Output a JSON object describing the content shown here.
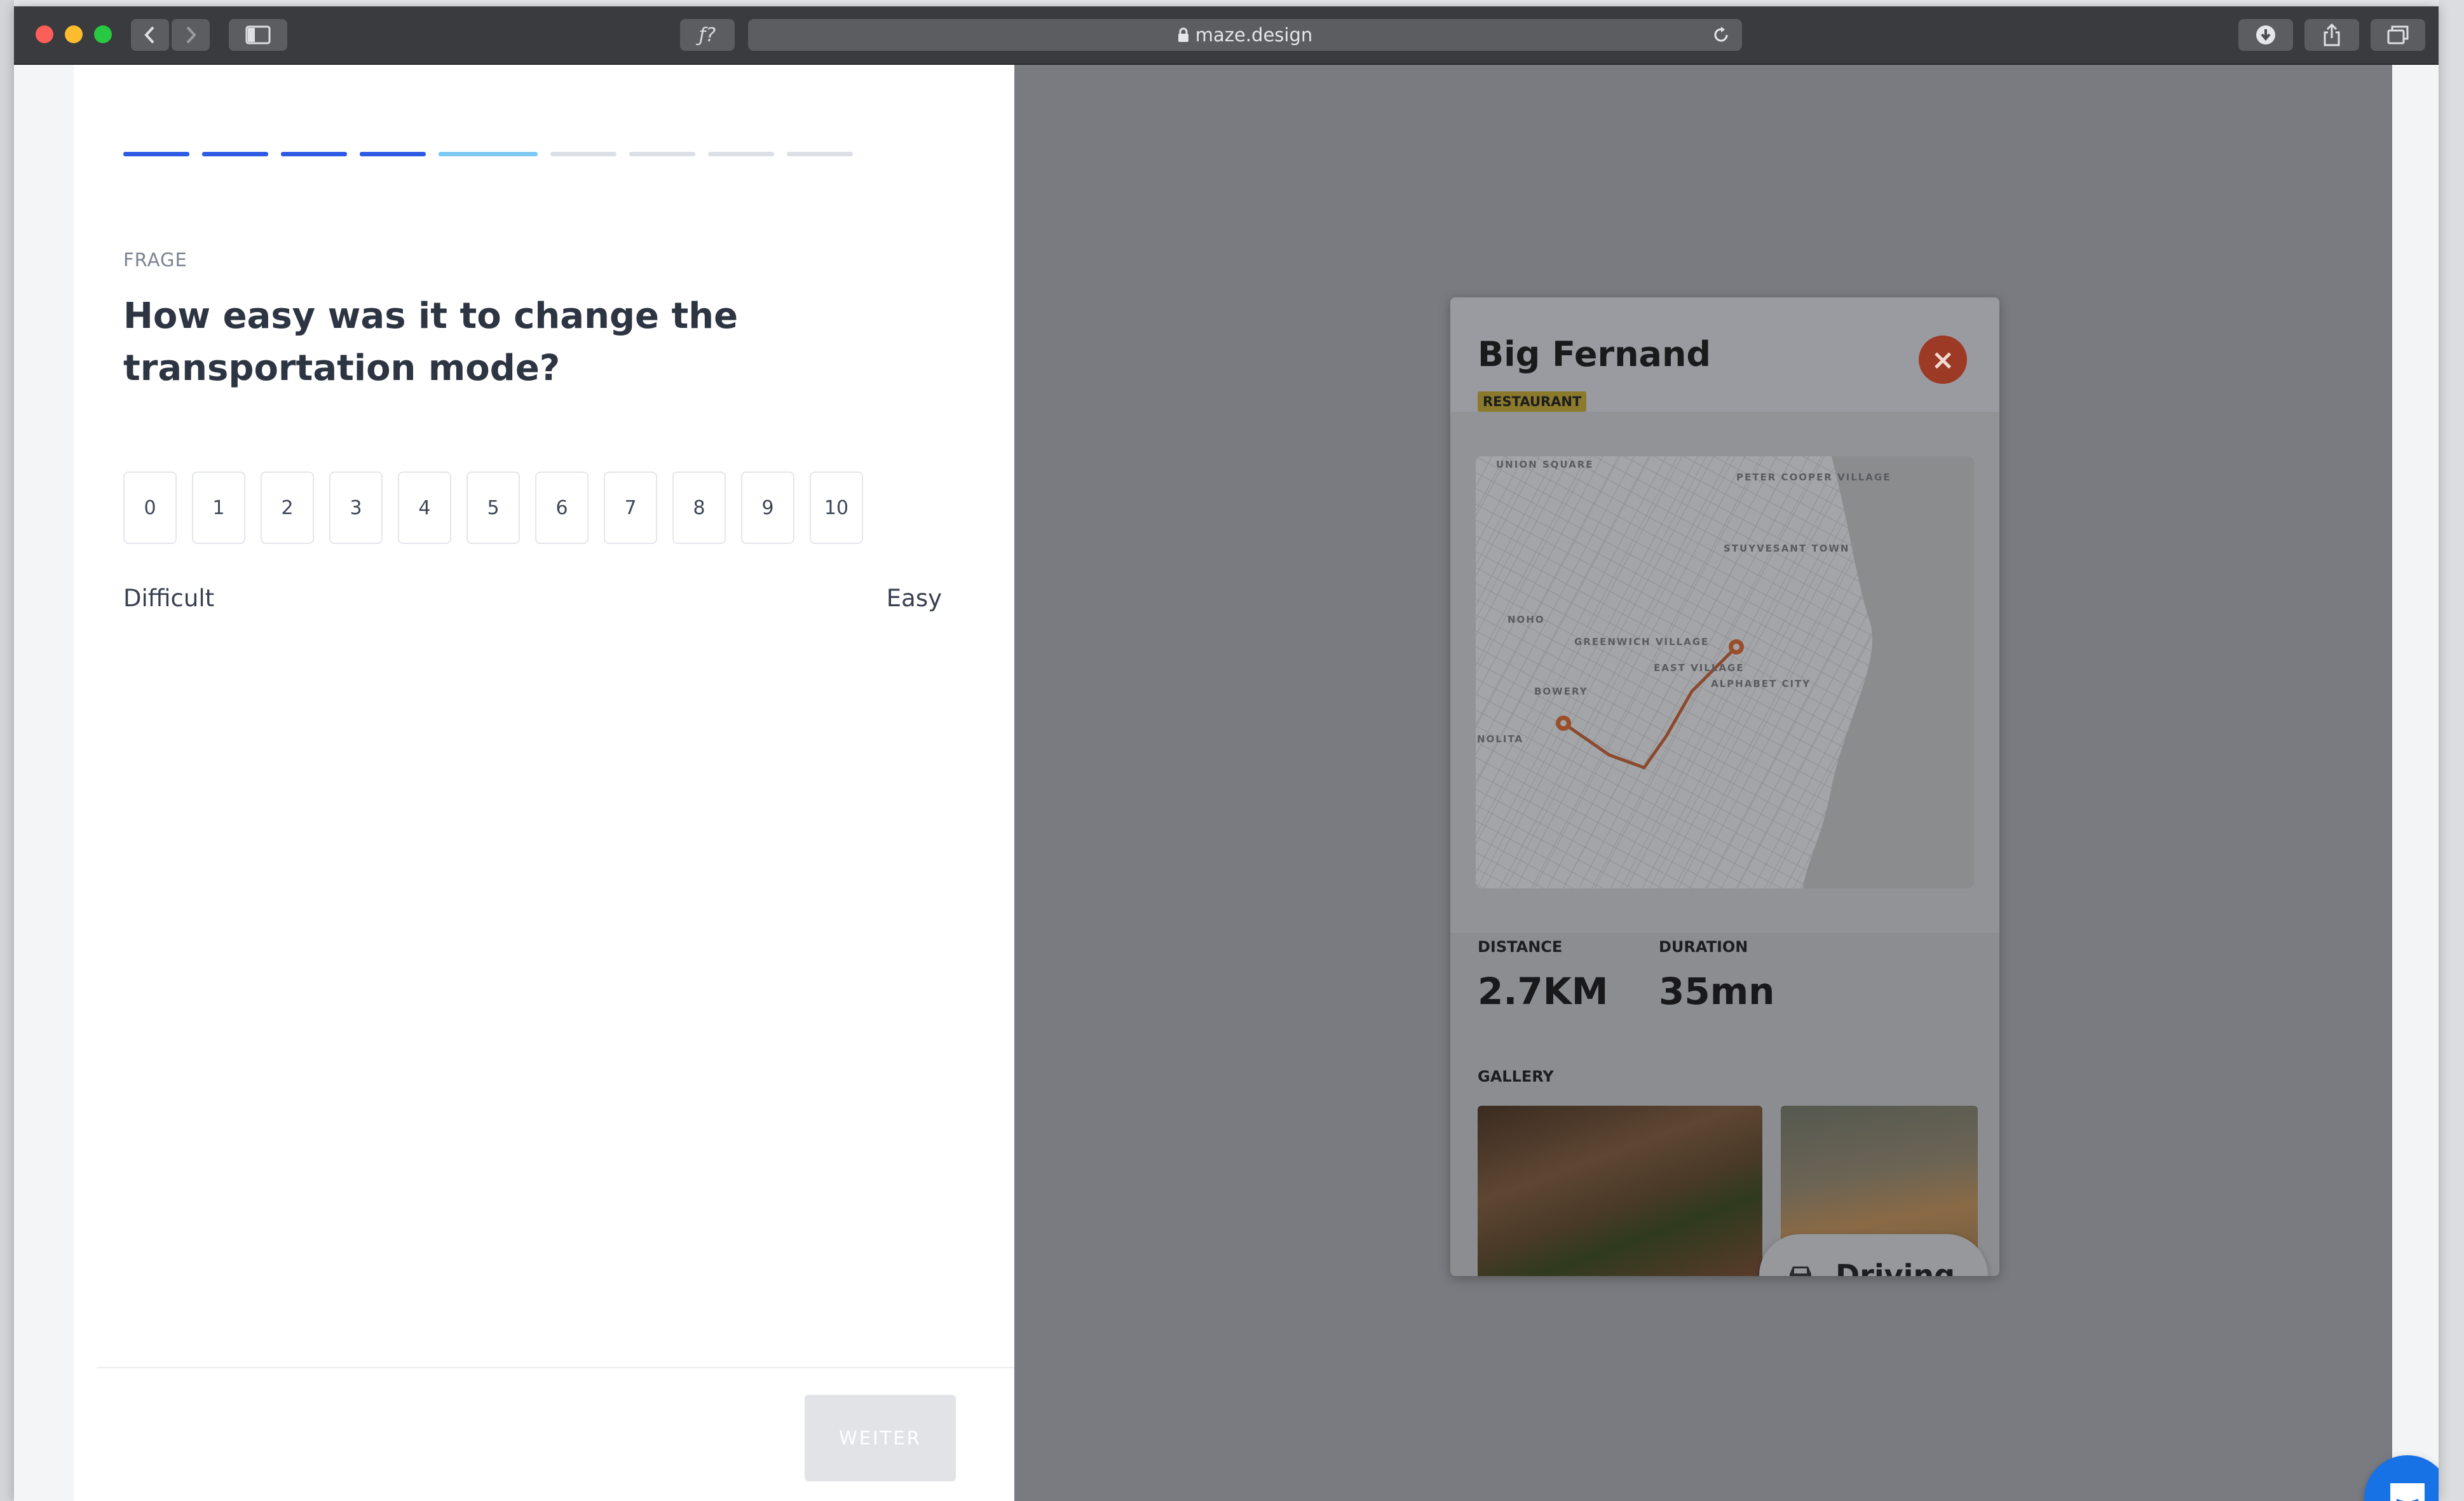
{
  "browser": {
    "url": "maze.design",
    "reader_label": "ƒ?"
  },
  "progress": {
    "segments": [
      "done",
      "done",
      "done",
      "done",
      "active",
      "todo",
      "todo",
      "todo",
      "todo"
    ]
  },
  "question": {
    "eyebrow": "FRAGE",
    "text": "How easy was it to change the transportation mode?",
    "scale": [
      "0",
      "1",
      "2",
      "3",
      "4",
      "5",
      "6",
      "7",
      "8",
      "9",
      "10"
    ],
    "min_label": "Difficult",
    "max_label": "Easy",
    "next_label": "WEITER"
  },
  "preview": {
    "title": "Big Fernand",
    "tag": "RESTAURANT",
    "map_labels": [
      "UNION SQUARE",
      "PETER COOPER VILLAGE",
      "STUYVESANT TOWN",
      "NOHO",
      "GREENWICH VILLAGE",
      "EAST VILLAGE",
      "ALPHABET CITY",
      "BOWERY",
      "NOLITA"
    ],
    "distance_label": "DISTANCE",
    "distance_value": "2.7KM",
    "duration_label": "DURATION",
    "duration_value": "35mn",
    "gallery_label": "GALLERY",
    "mode_label": "Driving"
  },
  "colors": {
    "progress_done": "#2e5be5",
    "progress_active": "#7ec8f5",
    "chat_button": "#1672e5"
  }
}
